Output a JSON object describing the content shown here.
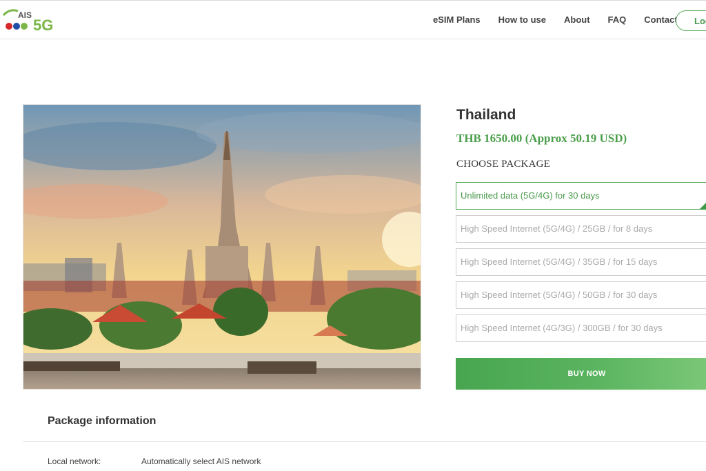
{
  "header": {
    "logo": {
      "brand": "AIS",
      "badge": "5G",
      "colors": {
        "green": "#7ab648",
        "red": "#d62a2a",
        "blue": "#1f4fa8"
      }
    },
    "nav": [
      "eSIM Plans",
      "How to use",
      "About",
      "FAQ",
      "Contact"
    ],
    "login_label": "Log"
  },
  "product": {
    "country": "Thailand",
    "price": "THB 1650.00 (Approx 50.19 USD)",
    "choose_label": "CHOOSE PACKAGE",
    "packages": [
      {
        "label": "Unlimited data (5G/4G) for 30 days",
        "selected": true
      },
      {
        "label": "High Speed Internet (5G/4G) / 25GB / for 8 days",
        "selected": false
      },
      {
        "label": "High Speed Internet (5G/4G) / 35GB / for 15 days",
        "selected": false
      },
      {
        "label": "High Speed Internet (5G/4G) / 50GB / for 30 days",
        "selected": false
      },
      {
        "label": "High Speed Internet (4G/3G) / 300GB / for 30 days",
        "selected": false
      }
    ],
    "buy_label": "BUY NOW",
    "accent_color": "#4a9e4a"
  },
  "info": {
    "title": "Package information",
    "rows": [
      {
        "label": "Local network:",
        "value": "Automatically select AIS network"
      }
    ]
  }
}
